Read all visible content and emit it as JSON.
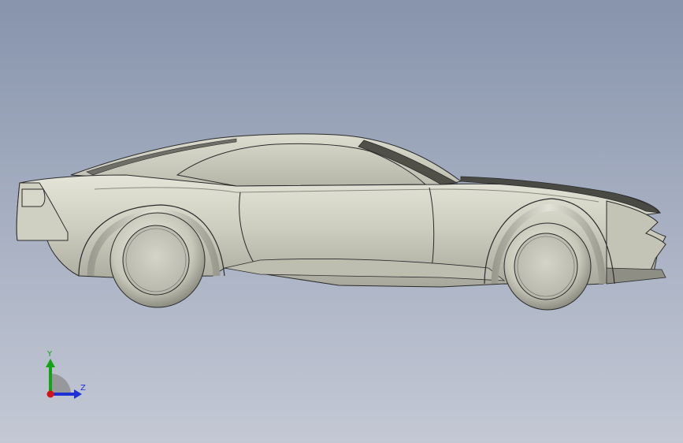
{
  "viewport": {
    "background_top": "#8794ac",
    "background_bottom": "#c3c8d4"
  },
  "model": {
    "body_color": "#c9c9bb",
    "shadow_color": "#8e8e84",
    "edge_color": "#2b2b2b",
    "tire_color": "#d2d2c4",
    "glass_color": "#c4c4b5"
  },
  "triad": {
    "y_label": "Y",
    "z_label": "Z",
    "y_color": "#14a314",
    "z_color": "#1e2fd6",
    "x_color": "#d21414",
    "icon": "coordinate-triad-icon"
  }
}
